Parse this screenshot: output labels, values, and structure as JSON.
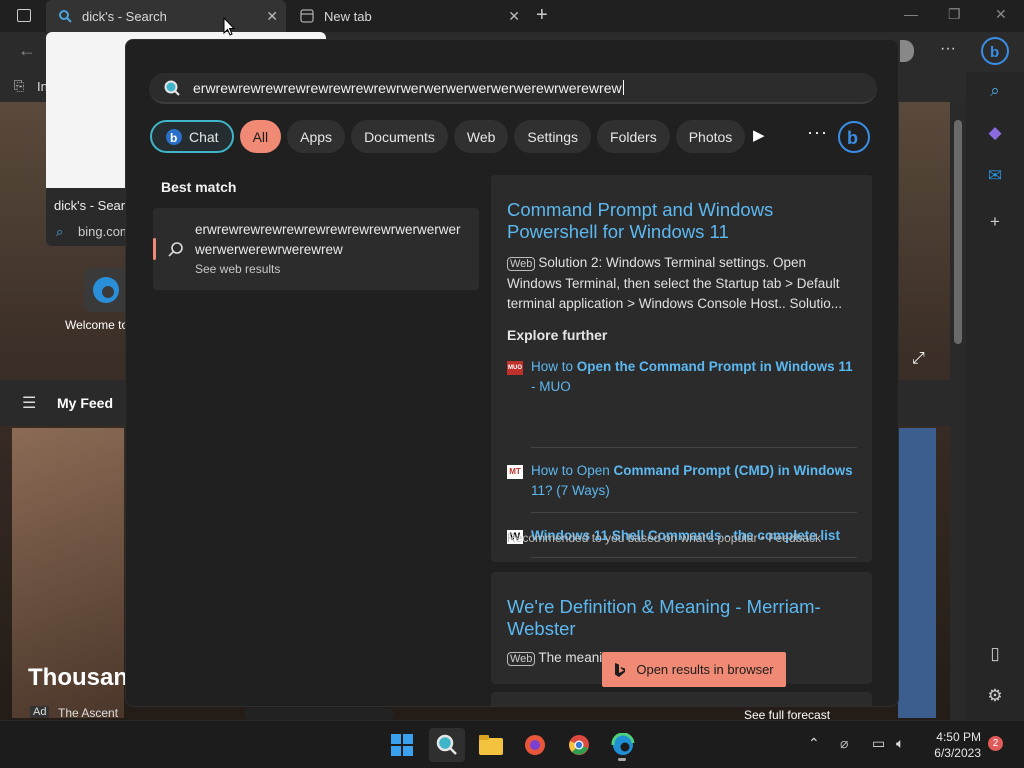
{
  "browser": {
    "tabs": [
      {
        "title": "dick's - Search",
        "active": true
      },
      {
        "title": "New tab",
        "active": false
      }
    ],
    "bookmark_partial": "In",
    "preview": {
      "title": "dick's - Search",
      "url": "bing.com"
    },
    "page": {
      "welcome_partial": "Welcome to",
      "my_feed": "My Feed",
      "headline_partial": "Thousan",
      "ad_badge": "Ad",
      "ad_source": "The Ascent",
      "see_full_forecast": "See full forecast"
    }
  },
  "search": {
    "query": "erwrewrewrewrewrewrewrewrewrwerwerwerwerwerwerewrwerewrew",
    "filters": [
      "All",
      "Apps",
      "Documents",
      "Web",
      "Settings",
      "Folders",
      "Photos"
    ],
    "chat_label": "Chat",
    "best_match_label": "Best match",
    "best_match": {
      "title": "erwrewrewrewrewrewrewrewrewrwerwerwerwerwerwerewrwerewrew",
      "subtitle": "See web results"
    },
    "result1": {
      "title": "Command Prompt and Windows Powershell for Windows 11",
      "web_tag": "Web",
      "snippet": "Solution 2: Windows Terminal settings. Open Windows Terminal, then select the Startup tab > Default terminal application > Windows Console Host.. Solutio..."
    },
    "explore_label": "Explore further",
    "explore": [
      {
        "logo": "MUO",
        "prefix": "How to ",
        "bold": "Open the Command Prompt in Windows 11",
        "suffix": " - MUO"
      },
      {
        "logo": "MT",
        "prefix": "How to Open ",
        "bold": "Command Prompt (CMD) in Windows",
        "suffix": " 11? (7 Ways)"
      },
      {
        "logo": "W",
        "prefix": "",
        "bold": "Windows 11 Shell Commands - the complete list",
        "suffix": ""
      }
    ],
    "recommended": "Recommended to you based on what's popular • Feedback",
    "result2": {
      "title": "We're Definition & Meaning - Merriam-Webster",
      "web_tag": "Web",
      "snippet": "The meani"
    },
    "open_in_browser": "Open results in browser"
  },
  "taskbar": {
    "apps": [
      "start-icon",
      "search-icon",
      "file-explorer-icon",
      "firefox-icon",
      "chrome-icon",
      "edge-icon"
    ],
    "time": "4:50 PM",
    "date": "6/3/2023",
    "notification_count": "2"
  },
  "colors": {
    "accent": "#f08a74",
    "link": "#5cb8f0",
    "chat_border": "#3fb5c9"
  }
}
